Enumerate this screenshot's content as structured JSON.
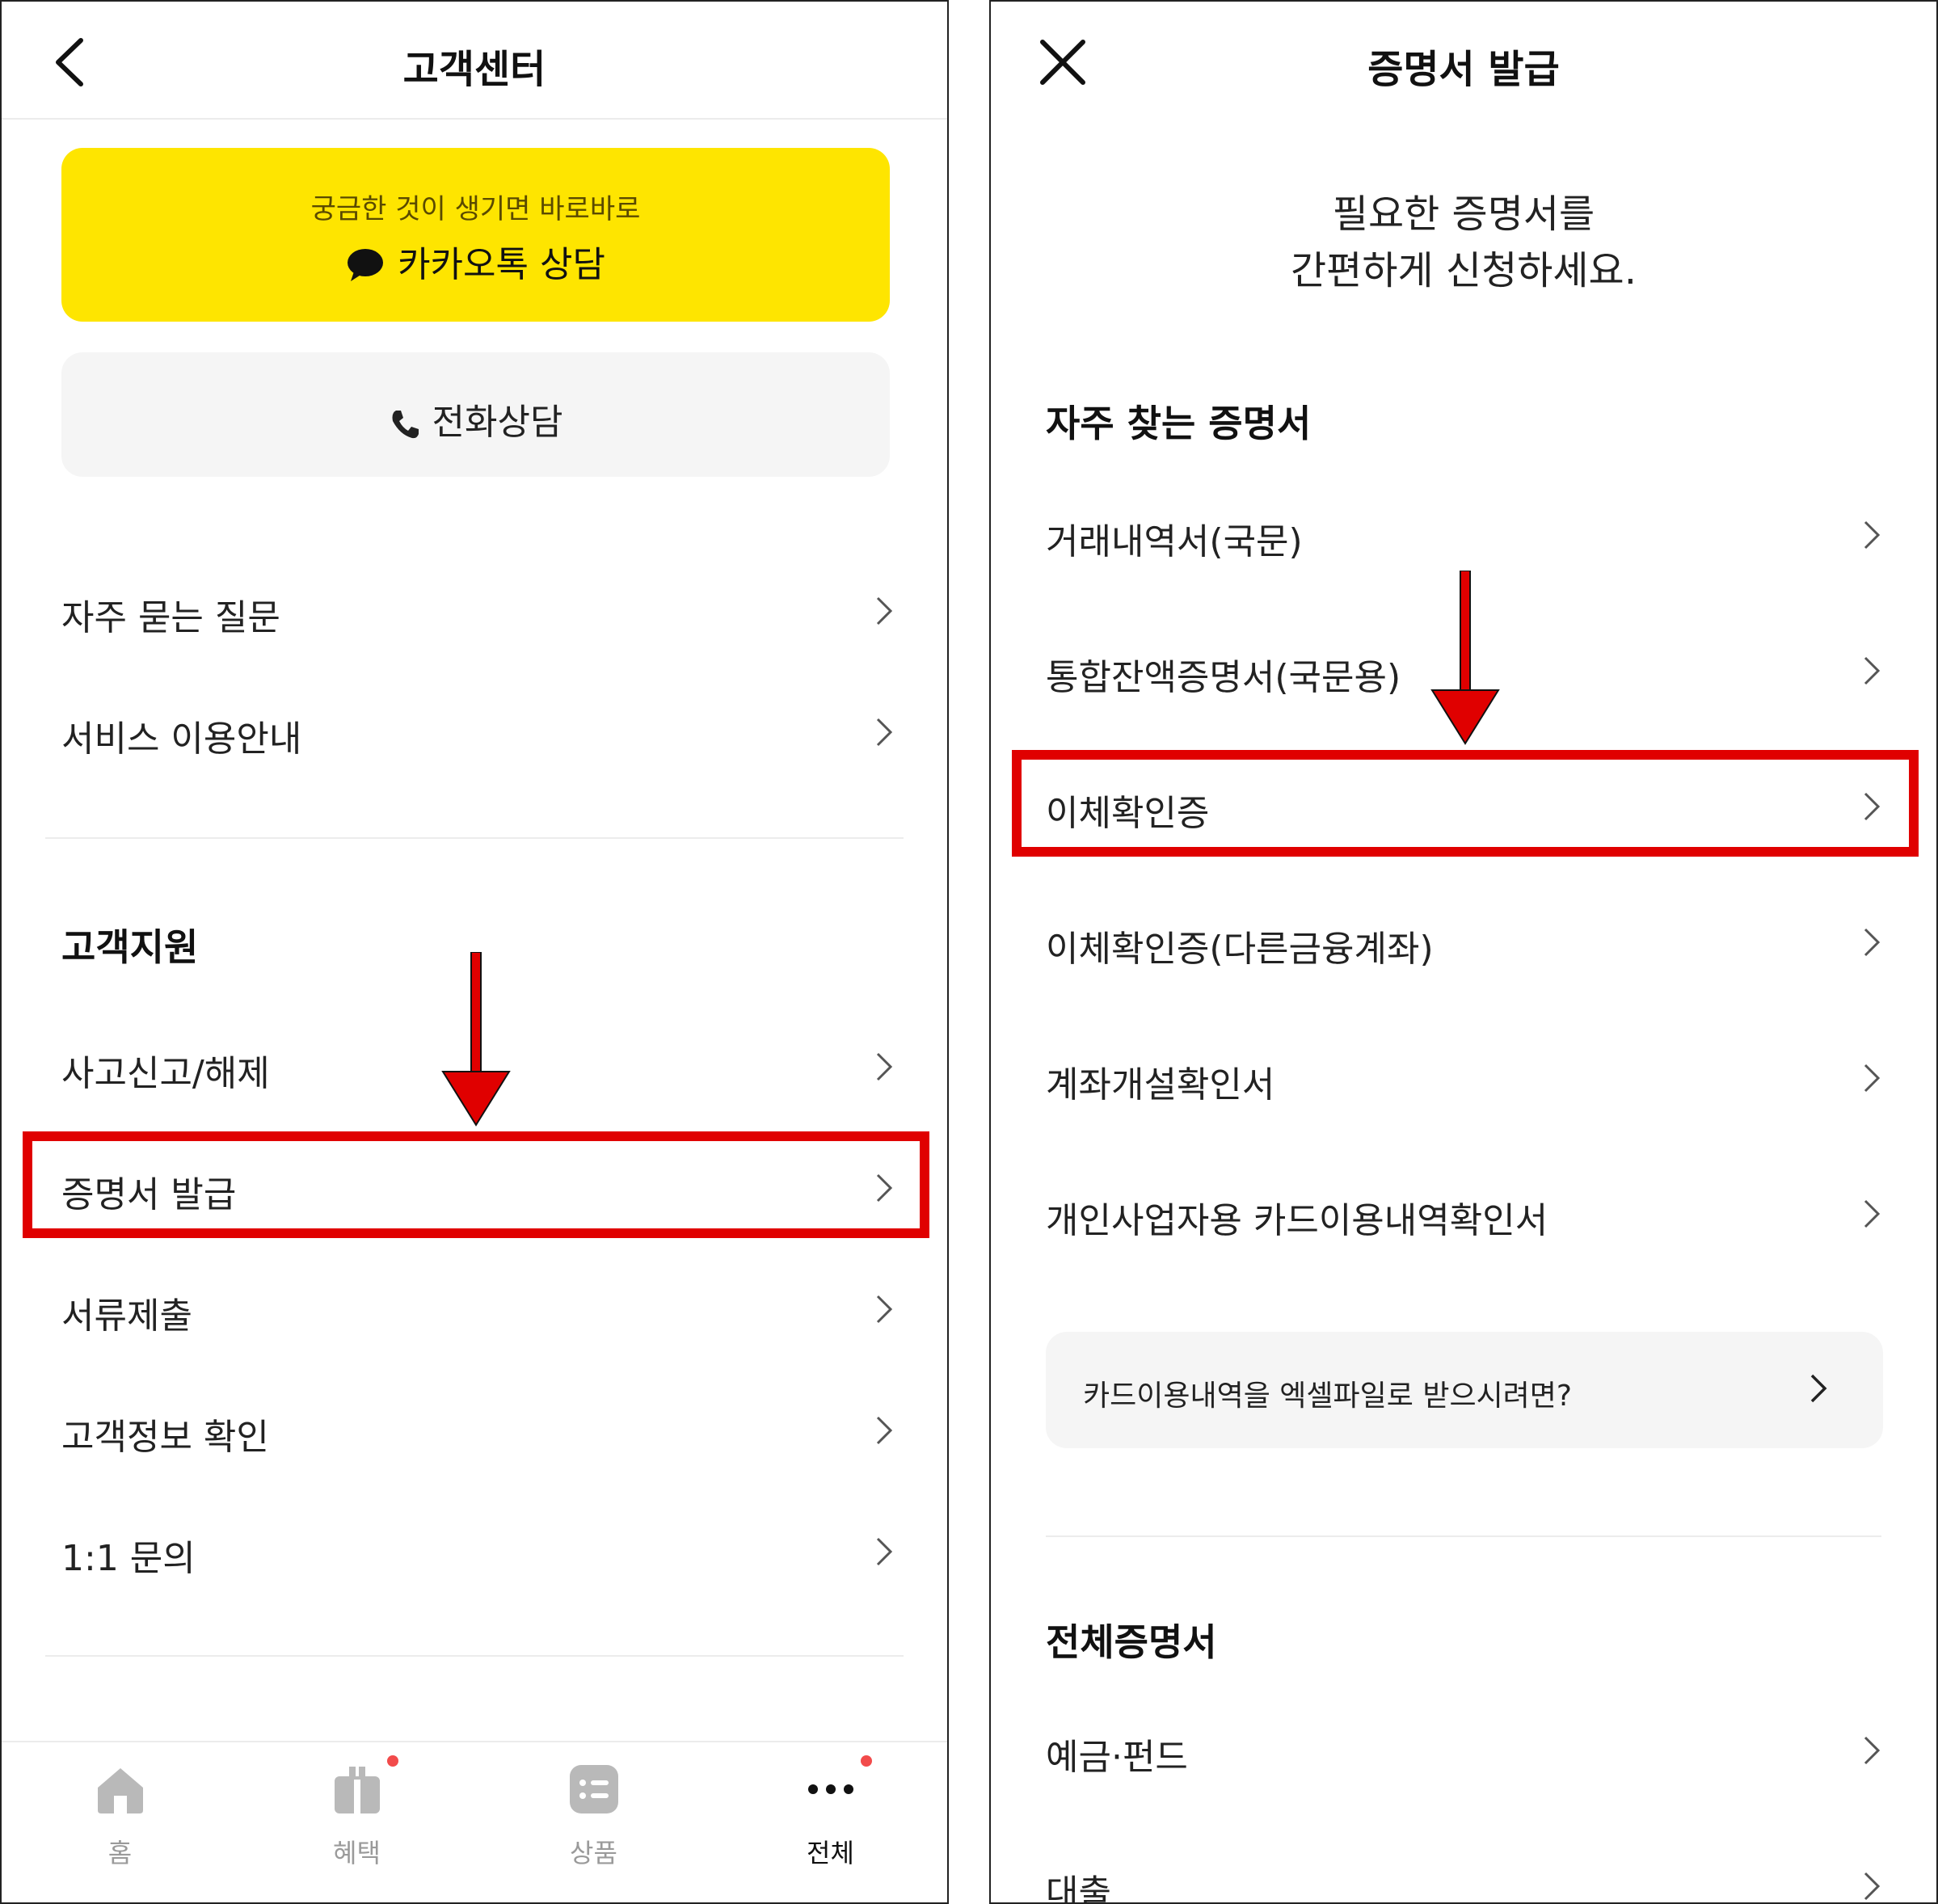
{
  "left": {
    "header": {
      "title": "고객센터"
    },
    "kakao": {
      "subtitle": "궁금한 것이 생기면 바로바로",
      "label": "카카오톡 상담"
    },
    "phone": {
      "label": "전화상담"
    },
    "menu1": [
      "자주 묻는 질문",
      "서비스 이용안내"
    ],
    "support": {
      "title": "고객지원",
      "items": [
        "사고신고/해제",
        "증명서 발급",
        "서류제출",
        "고객정보 확인",
        "1:1 문의"
      ]
    },
    "nav": [
      {
        "label": "홈",
        "icon": "home-icon",
        "badge": false,
        "active": false
      },
      {
        "label": "혜택",
        "icon": "gift-icon",
        "badge": true,
        "active": false
      },
      {
        "label": "상품",
        "icon": "list-icon",
        "badge": false,
        "active": false
      },
      {
        "label": "전체",
        "icon": "more-icon",
        "badge": true,
        "active": true
      }
    ]
  },
  "right": {
    "header": {
      "title": "증명서 발급"
    },
    "intro": {
      "line1": "필요한 증명서를",
      "line2": "간편하게 신청하세요."
    },
    "frequent": {
      "title": "자주 찾는 증명서",
      "items": [
        "거래내역서(국문)",
        "통합잔액증명서(국문용)",
        "이체확인증",
        "이체확인증(다른금융계좌)",
        "계좌개설확인서",
        "개인사업자용 카드이용내역확인서"
      ]
    },
    "excel": {
      "label": "카드이용내역을 엑셀파일로 받으시려면?"
    },
    "all": {
      "title": "전체증명서",
      "items": [
        "예금·펀드",
        "대출"
      ]
    }
  },
  "colors": {
    "kakao_yellow": "#FEE500",
    "highlight_red": "#E00000",
    "badge_red": "#F24B4B"
  }
}
